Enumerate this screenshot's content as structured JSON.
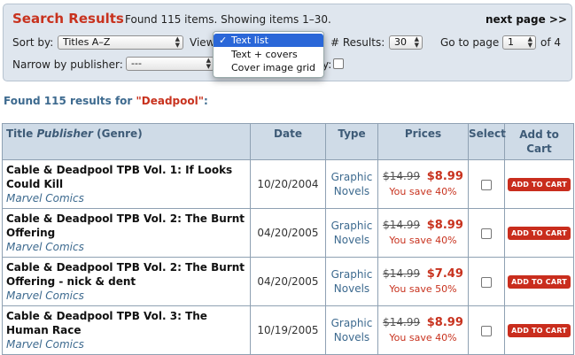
{
  "header": {
    "title": "Search Results",
    "summary": "Found 115 items.  Showing items 1–30.",
    "next_page": "next page >>"
  },
  "controls": {
    "sort_label": "Sort by:",
    "sort_value": "Titles A–Z",
    "view_label": "View",
    "results_label": "# Results:",
    "results_value": "30",
    "goto_label": "Go to page",
    "page_value": "1",
    "of_pages": "of 4",
    "narrow_label": "Narrow by publisher:",
    "publisher_value": "---",
    "hidden_label_fragment": "y:"
  },
  "view_dropdown": {
    "options": [
      "Text list",
      "Text + covers",
      "Cover image grid"
    ],
    "selected": "Text list",
    "check": "✓"
  },
  "found": {
    "prefix": "Found 115 results for ",
    "query": "\"Deadpool\"",
    "suffix": ":"
  },
  "table": {
    "headers": {
      "title": "Title ",
      "publisher": "Publisher",
      "genre": " (Genre)",
      "date": "Date",
      "type": "Type",
      "prices": "Prices",
      "select": "Select",
      "add_to_cart_1": "Add to",
      "add_to_cart_2": "Cart"
    },
    "rows": [
      {
        "title": "Cable & Deadpool TPB Vol. 1: If Looks Could Kill",
        "publisher": "Marvel Comics",
        "date": "10/20/2004",
        "type_1": "Graphic",
        "type_2": "Novels",
        "old_price": "$14.99",
        "new_price": "$8.99",
        "save": "You save 40%",
        "cart": "ADD TO CART"
      },
      {
        "title": "Cable & Deadpool TPB Vol. 2: The Burnt Offering",
        "publisher": "Marvel Comics",
        "date": "04/20/2005",
        "type_1": "Graphic",
        "type_2": "Novels",
        "old_price": "$14.99",
        "new_price": "$8.99",
        "save": "You save 40%",
        "cart": "ADD TO CART"
      },
      {
        "title": "Cable & Deadpool TPB Vol. 2: The Burnt Offering - nick & dent",
        "publisher": "Marvel Comics",
        "date": "04/20/2005",
        "type_1": "Graphic",
        "type_2": "Novels",
        "old_price": "$14.99",
        "new_price": "$7.49",
        "save": "You save 50%",
        "cart": "ADD TO CART"
      },
      {
        "title": "Cable & Deadpool TPB Vol. 3: The Human Race",
        "publisher": "Marvel Comics",
        "date": "10/19/2005",
        "type_1": "Graphic",
        "type_2": "Novels",
        "old_price": "$14.99",
        "new_price": "$8.99",
        "save": "You save 40%",
        "cart": "ADD TO CART"
      }
    ]
  },
  "colors": {
    "accent_red": "#c8321e",
    "panel_bg": "#dfe6ee",
    "header_bg": "#cfdbe7",
    "selection_blue": "#2a67d8"
  }
}
